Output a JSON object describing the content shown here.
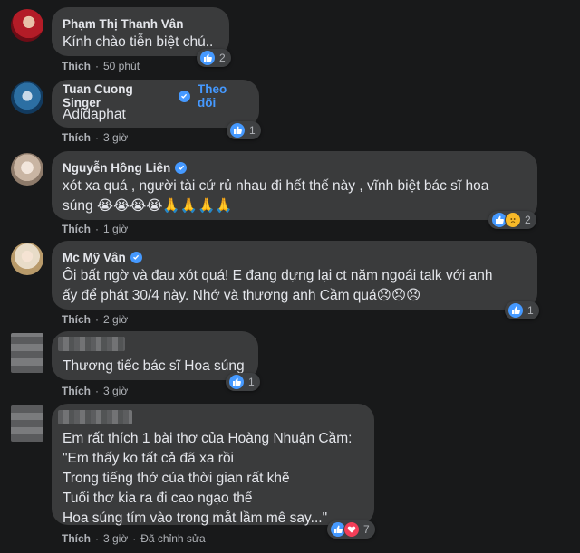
{
  "comments": [
    {
      "name": "Phạm Thị Thanh Vân",
      "text": "Kính chào tiễn biệt chú..",
      "like": "Thích",
      "time": "50 phút",
      "reactions": "2"
    },
    {
      "name": "Tuan Cuong Singer",
      "follow": "Theo dõi",
      "text": "Adidaphat",
      "like": "Thích",
      "time": "3 giờ",
      "reactions": "1"
    },
    {
      "name": "Nguyễn Hồng Liên",
      "text": "xót xa quá , người tài cứ rủ nhau đi hết thế này , vĩnh biệt bác sĩ hoa\nsúng 😭😭😭😭🙏🙏🙏🙏",
      "like": "Thích",
      "time": "1 giờ",
      "reactions": "2"
    },
    {
      "name": "Mc Mỹ Vân",
      "text": "Ôi bất ngờ và đau xót quá! E đang dựng lại ct năm ngoái talk với anh\nấy để phát 30/4 này. Nhớ và thương anh Cầm quá😞😞😞",
      "like": "Thích",
      "time": "2 giờ",
      "reactions": "1"
    },
    {
      "text": "Thương tiếc bác sĩ Hoa súng",
      "like": "Thích",
      "time": "3 giờ",
      "reactions": "1"
    },
    {
      "text": "Em rất thích 1 bài thơ của Hoàng Nhuận Cầm:\n\"Em thấy ko tất cả đã xa rồi\nTrong tiếng thở của thời gian rất khẽ\nTuổi thơ kia ra đi cao ngạo thế\nHoa súng tím vào trong mắt lầm mê say...\"",
      "like": "Thích",
      "time": "3 giờ",
      "edited": "Đã chỉnh sửa",
      "reactions": "7"
    }
  ],
  "colors": {
    "background": "#18191a",
    "bubble": "#3a3b3c",
    "like_blue": "#4599ff",
    "haha_yellow": "#f7b928",
    "love_red": "#f33e58"
  },
  "icons": [
    "like-icon",
    "sad-icon",
    "love-icon",
    "verified-badge-icon"
  ]
}
